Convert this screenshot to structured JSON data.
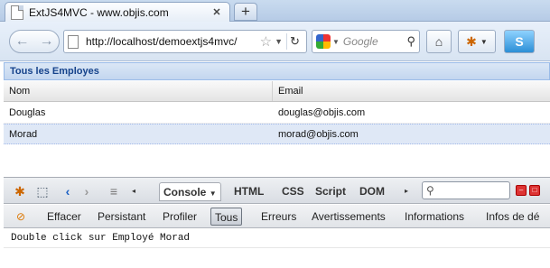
{
  "browser": {
    "tab_title": "ExtJS4MVC - www.objis.com",
    "new_tab_label": "+",
    "url": "http://localhost/demoextjs4mvc/",
    "search_placeholder": "Google"
  },
  "grid": {
    "title": "Tous les Employes",
    "columns": [
      "Nom",
      "Email"
    ],
    "rows": [
      {
        "name": "Douglas",
        "email": "douglas@objis.com"
      },
      {
        "name": "Morad",
        "email": "morad@objis.com"
      }
    ]
  },
  "firebug": {
    "tabs": [
      "Console",
      "HTML",
      "CSS",
      "Script",
      "DOM"
    ],
    "console_menu": [
      "Effacer",
      "Persistant",
      "Profiler",
      "Tous",
      "Erreurs",
      "Avertissements",
      "Informations",
      "Infos de dé"
    ],
    "active_filter": "Tous",
    "log": [
      "Double click sur Employé Morad"
    ]
  }
}
